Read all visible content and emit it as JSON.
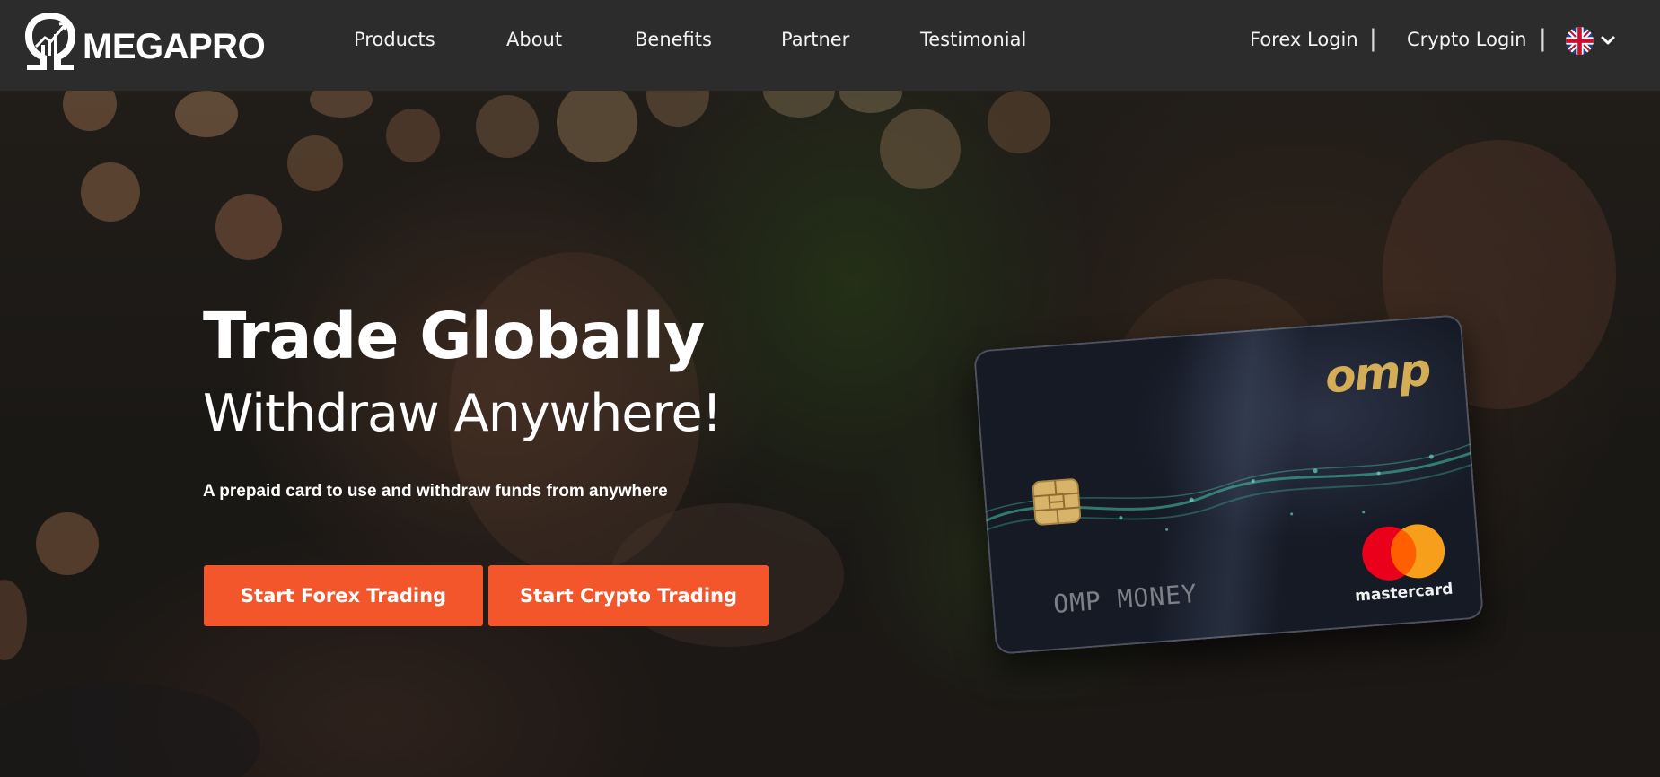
{
  "brand": {
    "logo_text": "MEGAPRO",
    "logo_icon": "omega-chart-icon"
  },
  "nav": {
    "items": [
      {
        "label": "Products"
      },
      {
        "label": "About"
      },
      {
        "label": "Benefits"
      },
      {
        "label": "Partner"
      },
      {
        "label": "Testimonial"
      }
    ],
    "forex_login": "Forex Login",
    "crypto_login": "Crypto Login",
    "separator": "|",
    "language_icon": "uk-flag-icon"
  },
  "hero": {
    "title": "Trade Globally",
    "subtitle": "Withdraw Anywhere!",
    "description": "A prepaid card to use and withdraw funds from anywhere",
    "cta_forex": "Start Forex Trading",
    "cta_crypto": "Start Crypto Trading"
  },
  "card": {
    "brand": "omp",
    "holder": "OMP MONEY",
    "network": "mastercard"
  },
  "colors": {
    "navbar_bg": "#2c2c2d",
    "accent": "#f4562c",
    "card_gold": "#d4ae56"
  }
}
